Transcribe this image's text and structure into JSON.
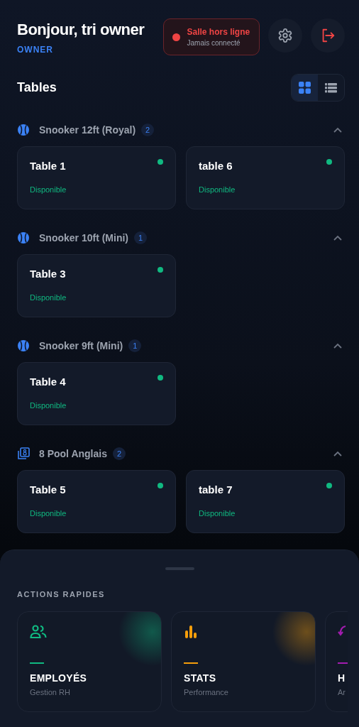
{
  "header": {
    "greeting": "Bonjour, tri owner",
    "role": "OWNER"
  },
  "connection": {
    "online": false,
    "title": "Salle hors ligne",
    "subtitle": "Jamais connecté"
  },
  "section": {
    "title": "Tables"
  },
  "view_toggle": [
    {
      "kind": "grid",
      "selected": true
    },
    {
      "kind": "list",
      "selected": false
    }
  ],
  "groups": [
    {
      "kind": "snooker",
      "name": "Snooker 12ft (Royal)",
      "count": "2",
      "expanded": true,
      "tables": [
        {
          "name": "Table 1",
          "status": "Disponible",
          "color": "#10b981"
        },
        {
          "name": "table 6",
          "status": "Disponible",
          "color": "#10b981"
        }
      ]
    },
    {
      "kind": "snooker",
      "name": "Snooker 10ft (Mini)",
      "count": "1",
      "expanded": true,
      "tables": [
        {
          "name": "Table 3",
          "status": "Disponible",
          "color": "#10b981"
        }
      ]
    },
    {
      "kind": "snooker",
      "name": "Snooker 9ft (Mini)",
      "count": "1",
      "expanded": true,
      "tables": [
        {
          "name": "Table 4",
          "status": "Disponible",
          "color": "#10b981"
        }
      ]
    },
    {
      "kind": "pool",
      "name": "8 Pool Anglais",
      "count": "2",
      "expanded": true,
      "tables": [
        {
          "name": "Table 5",
          "status": "Disponible",
          "color": "#10b981"
        },
        {
          "name": "table 7",
          "status": "Disponible",
          "color": "#10b981"
        }
      ]
    }
  ],
  "quick_actions": {
    "title": "ACTIONS RAPIDES",
    "items": [
      {
        "kind": "users",
        "title": "EMPLOYÉS",
        "subtitle": "Gestion RH",
        "color": "#10b981",
        "glow": true
      },
      {
        "kind": "chart",
        "title": "STATS",
        "subtitle": "Performance",
        "color": "#f59e0b",
        "glow": true
      },
      {
        "kind": "history",
        "title": "H",
        "subtitle": "Ar",
        "color": "#a21caf"
      }
    ]
  }
}
